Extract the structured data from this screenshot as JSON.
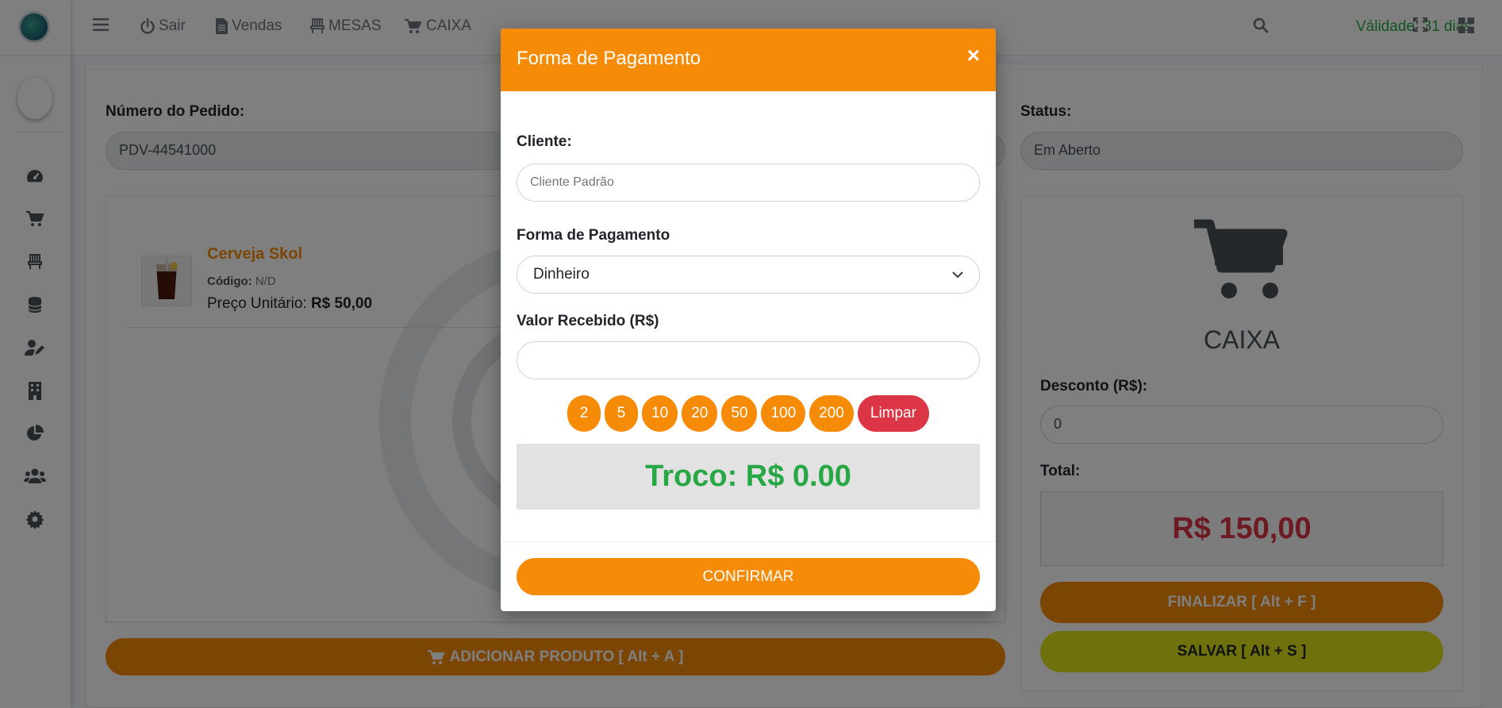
{
  "topbar": {
    "items": [
      {
        "label": "Sair",
        "icon": "power-icon"
      },
      {
        "label": "Vendas",
        "icon": "file-icon"
      },
      {
        "label": "MESAS",
        "icon": "chair-icon"
      },
      {
        "label": "CAIXA",
        "icon": "cart-icon"
      }
    ],
    "validity": "Válidade: 31 dias"
  },
  "sidebar": {
    "items": [
      "dashboard-icon",
      "cart-icon",
      "chair-icon",
      "database-icon",
      "user-edit-icon",
      "building-icon",
      "pie-chart-icon",
      "users-icon",
      "gear-icon"
    ]
  },
  "order": {
    "number_label": "Número do Pedido:",
    "number_value": "PDV-44541000",
    "status_label": "Status:",
    "status_value": "Em Aberto"
  },
  "product": {
    "name": "Cerveja Skol",
    "code_label": "Código:",
    "code_value": "N/D",
    "price_label": "Preço Unitário:",
    "price_value": "R$ 50,00"
  },
  "buttons": {
    "add_product": "ADICIONAR PRODUTO [ Alt + A ]",
    "finalize": "FINALIZAR [ Alt + F ]",
    "save": "SALVAR [ Alt + S ]"
  },
  "cashier": {
    "title": "CAIXA",
    "discount_label": "Desconto (R$):",
    "discount_value": "0",
    "total_label": "Total:",
    "total_value": "R$ 150,00"
  },
  "modal": {
    "title": "Forma de Pagamento",
    "close": "×",
    "client_label": "Cliente:",
    "client_placeholder": "Cliente Padrão",
    "payment_label": "Forma de Pagamento",
    "payment_selected": "Dinheiro",
    "received_label": "Valor Recebido (R$)",
    "received_value": "",
    "quick_values": [
      "2",
      "5",
      "10",
      "20",
      "50",
      "100",
      "200"
    ],
    "clear_label": "Limpar",
    "change_text": "Troco: R$ 0.00",
    "confirm_label": "CONFIRMAR"
  },
  "colors": {
    "accent": "#f68b08",
    "danger": "#dc3545",
    "success": "#28a745",
    "save": "#dfe21a"
  }
}
